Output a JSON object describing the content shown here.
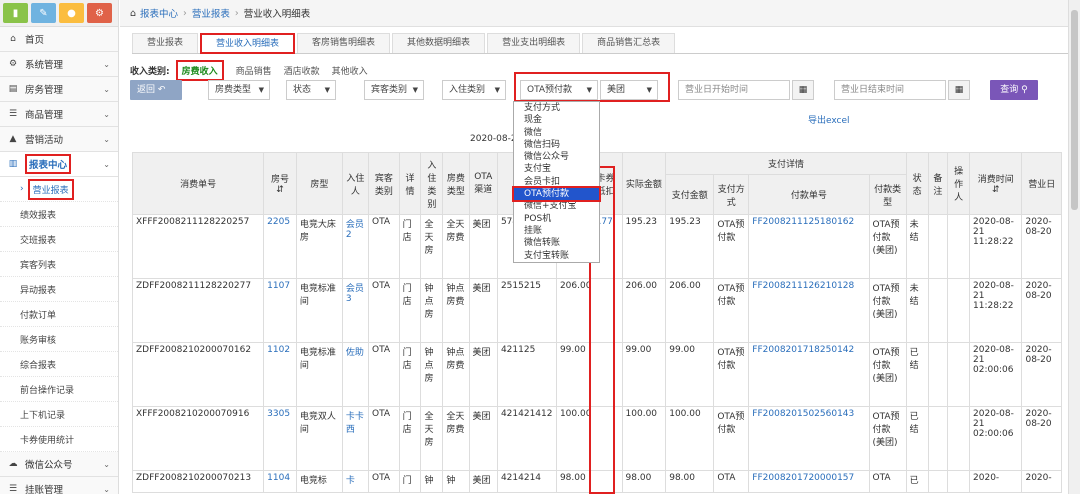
{
  "sidebar": {
    "quick_icons": [
      {
        "icon": "chart-icon",
        "color": "#8ac349"
      },
      {
        "icon": "pencil-icon",
        "color": "#6fb3e0"
      },
      {
        "icon": "users-icon",
        "color": "#fbbd3f"
      },
      {
        "icon": "cogs-icon",
        "color": "#e06248"
      }
    ],
    "items": [
      {
        "label": "首页",
        "icon": "home-icon"
      },
      {
        "label": "系统管理",
        "icon": "gear-icon"
      },
      {
        "label": "房务管理",
        "icon": "bank-icon"
      },
      {
        "label": "商品管理",
        "icon": "list-icon"
      },
      {
        "label": "营销活动",
        "icon": "gift-icon"
      },
      {
        "label": "报表中心",
        "icon": "bar-chart-icon"
      }
    ],
    "sub_items": [
      "营业报表",
      "绩效报表",
      "交班报表",
      "宾客列表",
      "异动报表",
      "付款订单",
      "账务审核",
      "综合报表",
      "前台操作记录",
      "上下机记录",
      "卡券使用统计"
    ],
    "bottom_items": [
      {
        "label": "微信公众号",
        "icon": "cloud-icon"
      },
      {
        "label": "挂账管理",
        "icon": "list-icon"
      }
    ]
  },
  "breadcrumb": {
    "root": "报表中心",
    "mid": "营业报表",
    "current": "营业收入明细表"
  },
  "tabs": [
    "营业报表",
    "营业收入明细表",
    "客房销售明细表",
    "其他数据明细表",
    "营业支出明细表",
    "商品销售汇总表"
  ],
  "filter": {
    "category_label": "收入类别:",
    "categories": [
      "房费收入",
      "商品销售",
      "酒店收款",
      "其他收入"
    ],
    "back_label": "返回",
    "room_type": "房费类型",
    "status": "状态",
    "guest_type": "宾客类别",
    "checkin_type": "入住类别",
    "payment": "OTA预付款",
    "channel": "美团",
    "start_placeholder": "营业日开始时间",
    "end_placeholder": "营业日结束时间",
    "query_label": "查询"
  },
  "export_label": "导出excel",
  "date_range": "2020-08-20 0            8-21 11:28:22",
  "dropdown_options": [
    "支付方式",
    "现金",
    "微信",
    "微信扫码",
    "微信公众号",
    "支付宝",
    "会员卡扣",
    "OTA预付款",
    "微信+支付宝",
    "POS机",
    "挂账",
    "微信转账",
    "支付宝转账"
  ],
  "table": {
    "headers": {
      "order_no": "消费单号",
      "room_no": "房号",
      "room_type": "房型",
      "guest": "入住人",
      "guest_cat": "宾客类别",
      "detail": "详情",
      "checkin_type": "入住类别",
      "fee_type": "房费类型",
      "ota_channel": "OTA渠道",
      "ota_no": "OTA",
      "coupon": "卡券抵扣",
      "actual": "实际金额",
      "pay_group": "支付详情",
      "pay_amount": "支付金额",
      "pay_method": "支付方式",
      "pay_no": "付款单号",
      "pay_type": "付款类型",
      "state": "状态",
      "remark": "备注",
      "operator": "操作人",
      "time": "消费时间",
      "biz_day": "营业日"
    },
    "rows": [
      {
        "order_no": "XFFF2008211128220257",
        "room_no": "2205",
        "room_type": "电竞大床房",
        "guest": "会员2",
        "guest_cat": "OTA",
        "detail": "门店",
        "checkin_type": "全天房",
        "fee_type": "全天房费",
        "ota_channel": "美团",
        "ota_no": "574",
        "amount": "",
        "coupon": "7.77",
        "actual": "195.23",
        "pay_amount": "195.23",
        "pay_method": "OTA预付款",
        "pay_no": "FF2008211125180162",
        "pay_type": "OTA预付款(美团)",
        "state": "未结",
        "time": "2020-08-21 11:28:22",
        "biz_day": "2020-08-20"
      },
      {
        "order_no": "ZDFF2008211128220277",
        "room_no": "1107",
        "room_type": "电竞标准间",
        "guest": "会员3",
        "guest_cat": "OTA",
        "detail": "门店",
        "checkin_type": "钟点房",
        "fee_type": "钟点房费",
        "ota_channel": "美团",
        "ota_no": "2515215",
        "amount": "206.00",
        "coupon": "",
        "actual": "206.00",
        "pay_amount": "206.00",
        "pay_method": "OTA预付款",
        "pay_no": "FF2008211126210128",
        "pay_type": "OTA预付款(美团)",
        "state": "未结",
        "time": "2020-08-21 11:28:22",
        "biz_day": "2020-08-20"
      },
      {
        "order_no": "ZDFF2008210200070162",
        "room_no": "1102",
        "room_type": "电竞标准间",
        "guest": "佐助",
        "guest_cat": "OTA",
        "detail": "门店",
        "checkin_type": "钟点房",
        "fee_type": "钟点房费",
        "ota_channel": "美团",
        "ota_no": "421125",
        "amount": "99.00",
        "coupon": "",
        "actual": "99.00",
        "pay_amount": "99.00",
        "pay_method": "OTA预付款",
        "pay_no": "FF2008201718250142",
        "pay_type": "OTA预付款(美团)",
        "state": "已结",
        "time": "2020-08-21 02:00:06",
        "biz_day": "2020-08-20"
      },
      {
        "order_no": "XFFF2008210200070916",
        "room_no": "3305",
        "room_type": "电竞双人间",
        "guest": "卡卡西",
        "guest_cat": "OTA",
        "detail": "门店",
        "checkin_type": "全天房",
        "fee_type": "全天房费",
        "ota_channel": "美团",
        "ota_no": "421421412",
        "amount": "100.00",
        "coupon": "",
        "actual": "100.00",
        "pay_amount": "100.00",
        "pay_method": "OTA预付款",
        "pay_no": "FF2008201502560143",
        "pay_type": "OTA预付款(美团)",
        "state": "已结",
        "time": "2020-08-21 02:00:06",
        "biz_day": "2020-08-20"
      },
      {
        "order_no": "ZDFF2008210200070213",
        "room_no": "1104",
        "room_type": "电竞标",
        "guest": "卡",
        "guest_cat": "OTA",
        "detail": "门",
        "checkin_type": "钟",
        "fee_type": "钟",
        "ota_channel": "美团",
        "ota_no": "4214214",
        "amount": "98.00",
        "coupon": "",
        "actual": "98.00",
        "pay_amount": "98.00",
        "pay_method": "OTA",
        "pay_no": "FF2008201720000157",
        "pay_type": "OTA",
        "state": "已",
        "time": "2020-",
        "biz_day": "2020-"
      }
    ]
  }
}
